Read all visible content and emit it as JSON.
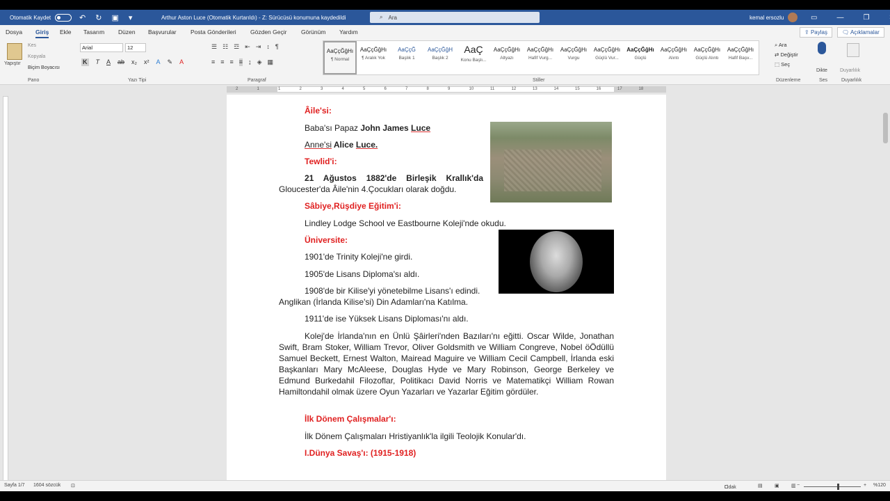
{
  "titlebar": {
    "autosave_label": "Otomatik Kaydet",
    "doc_title": "Arthur Aston Luce (Otomatik Kurtarıldı)  -  Z: Sürücüsü konumuna kaydedildi",
    "search_placeholder": "Ara",
    "user_name": "kemal ersozlu",
    "accent": "#2b579a"
  },
  "tabs": [
    "Dosya",
    "Giriş",
    "Ekle",
    "Tasarım",
    "Düzen",
    "Başvurular",
    "Posta Gönderileri",
    "Gözden Geçir",
    "Görünüm",
    "Yardım"
  ],
  "active_tab": "Giriş",
  "share_label": "Paylaş",
  "comments_label": "Açıklamalar",
  "ribbon": {
    "clipboard": {
      "paste": "Yapıştır",
      "cut": "Kes",
      "copy": "Kopyala",
      "format_painter": "Biçim Boyacısı",
      "group": "Pano"
    },
    "font": {
      "name": "Arial",
      "size": "12",
      "group": "Yazı Tipi"
    },
    "paragraph": {
      "group": "Paragraf"
    },
    "styles": {
      "group": "Stiller",
      "items": [
        {
          "sample": "AaÇçĞğHı",
          "name": "¶ Normal"
        },
        {
          "sample": "AaÇçĞğHı",
          "name": "¶ Aralık Yok"
        },
        {
          "sample": "AaÇçĞ",
          "name": "Başlık 1"
        },
        {
          "sample": "AaÇçĞğH",
          "name": "Başlık 2"
        },
        {
          "sample": "AaÇ",
          "name": "Konu Başlı..."
        },
        {
          "sample": "AaÇçĞğHı",
          "name": "Altyazı"
        },
        {
          "sample": "AaÇçĞğHı",
          "name": "Hafif Vurg..."
        },
        {
          "sample": "AaÇçĞğHı",
          "name": "Vurgu"
        },
        {
          "sample": "AaÇçĞğHı",
          "name": "Güçlü Vur..."
        },
        {
          "sample": "AaÇçĞğHı",
          "name": "Güçlü"
        },
        {
          "sample": "AaÇçĞğHı",
          "name": "Alıntı"
        },
        {
          "sample": "AaÇçĞğHı",
          "name": "Güçlü Alıntı"
        },
        {
          "sample": "AaÇçĞğHı",
          "name": "Hafif Başv..."
        }
      ]
    },
    "editing": {
      "find": "Ara",
      "replace": "Değiştir",
      "select": "Seç",
      "group": "Düzenleme"
    },
    "voice": {
      "dictate": "Dikte",
      "group": "Ses"
    },
    "sensitivity": {
      "label": "Duyarlılık",
      "group": "Duyarlılık"
    }
  },
  "ruler_numbers": [
    "2",
    "1",
    "1",
    "2",
    "3",
    "4",
    "5",
    "6",
    "7",
    "8",
    "9",
    "10",
    "11",
    "12",
    "13",
    "14",
    "15",
    "16",
    "17",
    "18"
  ],
  "document": {
    "h_aile": "Âile'si:",
    "baba_pre": "Baba'sı Papaz ",
    "baba_name": "John James ",
    "baba_luce": "Luce",
    "anne_pre": "Anne'si",
    "anne_name": " Alice ",
    "anne_luce": "Luce.",
    "h_tewlid": "Tewlid'i:",
    "birth_line1": "21 Ağustos 1882'de Birleşik Krallık'da",
    "birth_line2": "Gloucester'da  Âile'nin 4.Çocukları olarak doğdu.",
    "h_egitim": "Sâbiye,Rüşdiye Eğitim'i:",
    "school": "Lindley Lodge School ve Eastbourne Koleji'nde okudu.",
    "h_uni": "Üniversite:",
    "y1901": "1901'de Trinity Koleji'ne girdi.",
    "y1905": "1905'de Lisans Diploma'sı aldı.",
    "y1908_l1": "1908'de bir Kilise'yi yönetebilme Lisans'ı edindi.",
    "y1908_l2": "Anglikan (İrlanda Kilise'si) Din Adamları'na Katılma.",
    "y1911": "1911'de ise Yüksek Lisans Diploması'nı aldı.",
    "college_para": "Kolej'de İrlanda'nın en Ünlü Şâirleri'nden Bazıları'nı eğitti. Oscar Wilde, Jonathan Swift, Bram Stoker, William Trevor, Oliver Goldsmith ve William Congreve, Nobel öÖdüllü Samuel Beckett, Ernest Walton, Mairead Maguire ve William Cecil Campbell, İrlanda eski Başkanları Mary McAleese, Douglas Hyde ve Mary Robinson, George Berkeley ve Edmund Burkedahil Filozoflar, Politikacı David Norris ve Matematikçi William Rowan Hamiltondahil olmak üzere Oyun Yazarları ve Yazarlar Eğitim gördüler.",
    "h_ilk": "İlk Dönem Çalışmalar'ı:",
    "ilk_text": "İlk Dönem Çalışmaları Hristiyanlık'la ilgili Teolojik Konular'dı.",
    "h_war": "I.Dünya Savaş'ı: (1915-1918)"
  },
  "statusbar": {
    "page": "Sayfa 1/7",
    "words": "1604 sözcük",
    "focus": "Odak",
    "zoom": "%120",
    "zoom_level": 0.6
  }
}
